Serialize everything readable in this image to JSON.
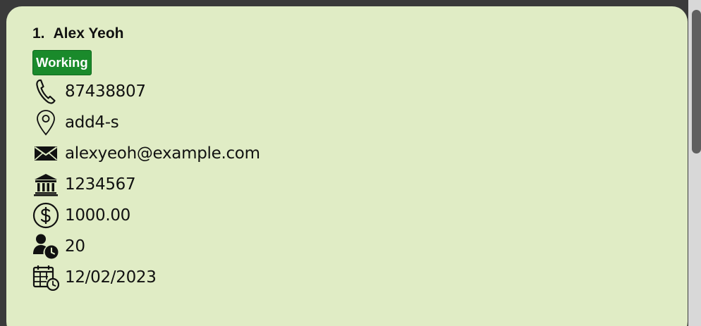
{
  "person": {
    "index": "1.",
    "name": "Alex Yeoh",
    "tag": "Working",
    "tag_color": "#1a8a2b",
    "fields": [
      {
        "icon": "phone-icon",
        "value": "87438807"
      },
      {
        "icon": "location-pin-icon",
        "value": "add4-s"
      },
      {
        "icon": "envelope-icon",
        "value": "alexyeoh@example.com"
      },
      {
        "icon": "bank-icon",
        "value": "1234567"
      },
      {
        "icon": "dollar-icon",
        "value": "1000.00"
      },
      {
        "icon": "person-clock-icon",
        "value": "20"
      },
      {
        "icon": "calendar-clock-icon",
        "value": "12/02/2023"
      }
    ]
  },
  "colors": {
    "card_background": "#e0ecc5",
    "window_background": "#3a3a3a",
    "scrollbar_thumb": "#5f5f5f"
  }
}
